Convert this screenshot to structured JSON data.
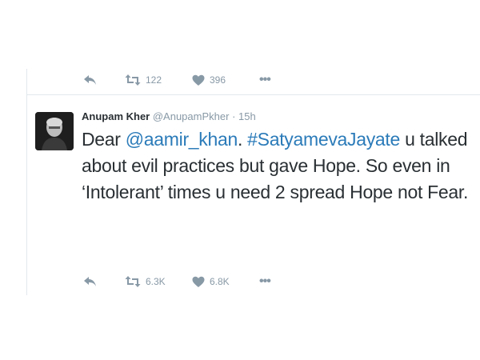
{
  "prev_tweet": {
    "actions": {
      "retweet_count": "122",
      "like_count": "396"
    }
  },
  "tweet": {
    "author_name": "Anupam Kher",
    "author_handle": "@AnupamPkher",
    "separator": "·",
    "time_ago": "15h",
    "text": {
      "prefix": "Dear ",
      "mention": "@aamir_khan",
      "middle": ". ",
      "hashtag": "#SatyamevaJayate",
      "rest": " u talked about evil practices but gave Hope. So even in ‘Intolerant’ times u need 2 spread Hope not Fear."
    },
    "actions": {
      "retweet_count": "6.3K",
      "like_count": "6.8K"
    }
  },
  "icons": {
    "reply": "reply-icon",
    "retweet": "retweet-icon",
    "like": "heart-icon",
    "more": "more-icon"
  },
  "colors": {
    "link": "#2b7bb9",
    "meta": "#8899a6",
    "text": "#292f33",
    "border": "#e1e8ed"
  }
}
